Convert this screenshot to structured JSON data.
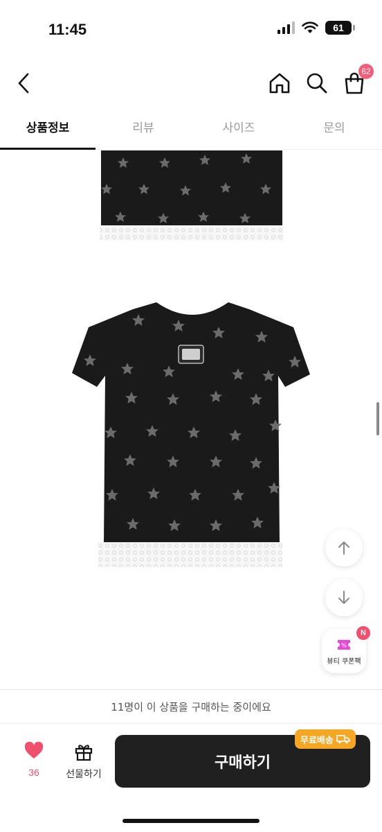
{
  "status": {
    "time": "11:45",
    "battery": "61"
  },
  "nav": {
    "cart_count": "62"
  },
  "tabs": [
    {
      "label": "상품정보",
      "active": true
    },
    {
      "label": "리뷰",
      "active": false
    },
    {
      "label": "사이즈",
      "active": false
    },
    {
      "label": "문의",
      "active": false
    }
  ],
  "floating": {
    "coupon_label": "뷰티 쿠폰팩",
    "coupon_badge": "N"
  },
  "buyers_text": "11명이 이 상품을 구매하는 중이에요",
  "bottom": {
    "like_count": "36",
    "gift_label": "선물하기",
    "buy_label": "구매하기",
    "shipping_badge": "무료배송"
  },
  "colors": {
    "accent": "#f0506e",
    "buy_button": "#202020",
    "shipping": "#f5a623"
  }
}
